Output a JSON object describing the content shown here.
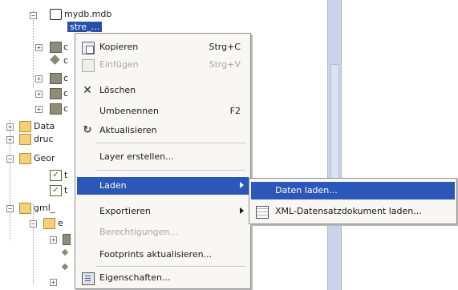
{
  "tree": {
    "root_label": "mydb.mdb",
    "selected_label": "stre_...",
    "items": [
      {
        "label": "c"
      },
      {
        "label": "c"
      },
      {
        "label": "c"
      },
      {
        "label": "c"
      },
      {
        "label": "c"
      },
      {
        "label": "Data"
      },
      {
        "label": "druc"
      },
      {
        "label": "Geor"
      },
      {
        "label": "t"
      },
      {
        "label": "t"
      },
      {
        "label": "gml_"
      },
      {
        "label": "e"
      }
    ]
  },
  "context_menu": {
    "items": [
      {
        "label": "Kopieren",
        "shortcut": "Strg+C",
        "icon": "copy-icon",
        "enabled": true
      },
      {
        "label": "Einfügen",
        "shortcut": "Strg+V",
        "icon": "paste-icon",
        "enabled": false
      },
      {
        "label": "Löschen",
        "shortcut": "",
        "icon": "delete-icon",
        "enabled": true
      },
      {
        "label": "Umbenennen",
        "shortcut": "F2",
        "icon": "",
        "enabled": true
      },
      {
        "label": "Aktualisieren",
        "shortcut": "",
        "icon": "refresh-icon",
        "enabled": true
      },
      {
        "label": "Layer erstellen...",
        "shortcut": "",
        "icon": "",
        "enabled": true
      },
      {
        "label": "Laden",
        "shortcut": "",
        "icon": "",
        "enabled": true,
        "highlighted": true,
        "submenu": true
      },
      {
        "label": "Exportieren",
        "shortcut": "",
        "icon": "",
        "enabled": true,
        "submenu": true
      },
      {
        "label": "Berechtigungen...",
        "shortcut": "",
        "icon": "",
        "enabled": false
      },
      {
        "label": "Footprints aktualisieren...",
        "shortcut": "",
        "icon": "",
        "enabled": true
      },
      {
        "label": "Eigenschaften...",
        "shortcut": "",
        "icon": "properties-icon",
        "enabled": true
      }
    ]
  },
  "submenu": {
    "items": [
      {
        "label": "Daten laden...",
        "icon": "",
        "highlighted": true
      },
      {
        "label": "XML-Datensatzdokument laden...",
        "icon": "xml-grid-icon",
        "highlighted": false
      }
    ]
  },
  "colors": {
    "highlight": "#2b58b8",
    "menu_bg": "#f8f7f3",
    "scrollbar": "#c9d4ea"
  }
}
